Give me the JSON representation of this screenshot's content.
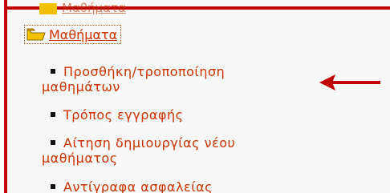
{
  "menu": {
    "top_partial_label": "Μαθήματα",
    "section_label": "Μαθήματα",
    "items": [
      {
        "line1": "Προσθήκη/τροποποίηση",
        "line2": "μαθημάτων"
      },
      {
        "line1": "Τρόπος εγγραφής",
        "line2": ""
      },
      {
        "line1": "Αίτηση δημιουργίας νέου",
        "line2": "μαθήματος"
      },
      {
        "line1": "Αντίγραφα ασφαλείας",
        "line2": ""
      }
    ]
  },
  "icons": {
    "section": "folder-open-icon",
    "annotation": "red-arrow-icon",
    "bullet": "square-bullet-icon"
  },
  "colors": {
    "frame": "#c00000",
    "link": "#cc3300",
    "folder": "#f2c200"
  }
}
